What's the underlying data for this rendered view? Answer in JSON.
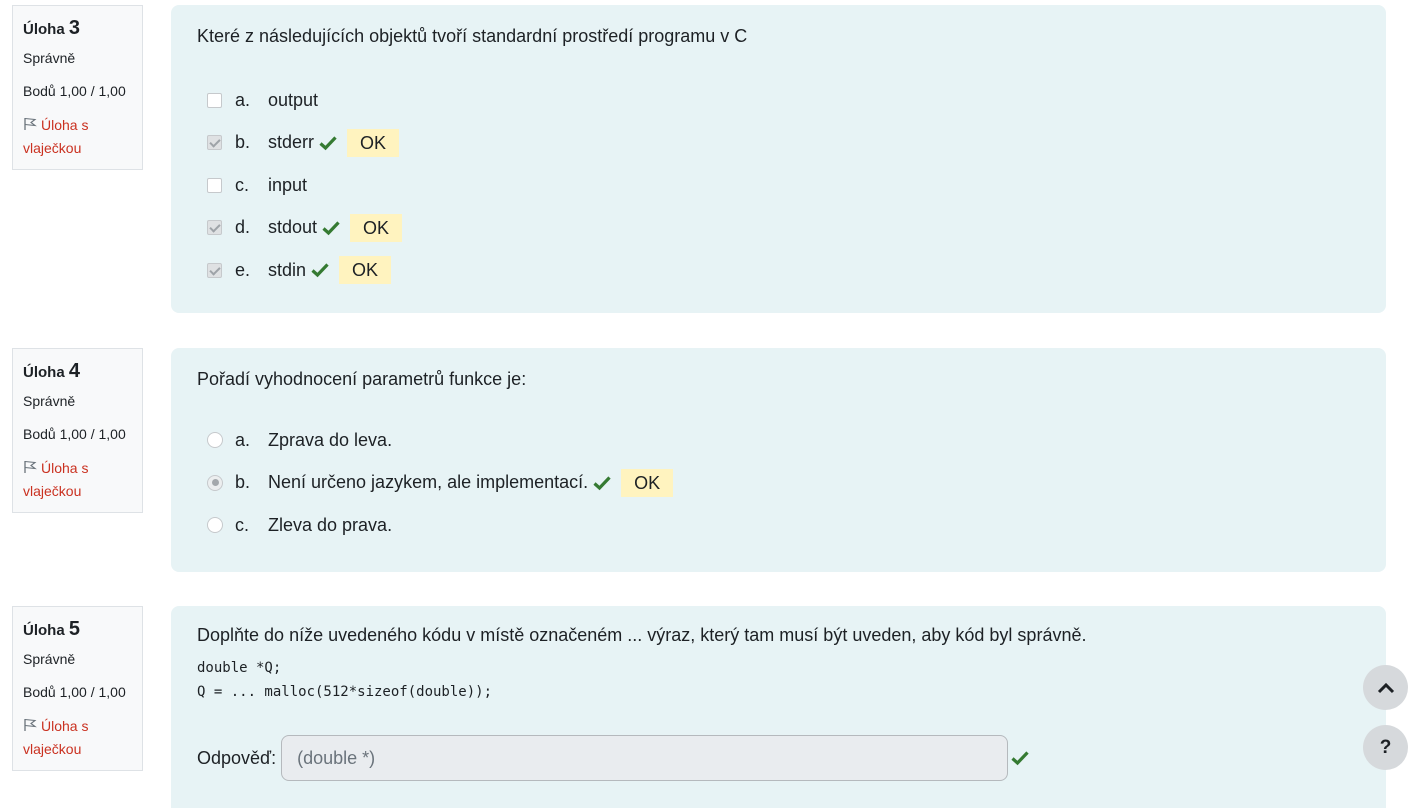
{
  "colors": {
    "content_bg": "#e7f3f5",
    "info_bg": "#f8f9fa",
    "flag_red": "#ca3120",
    "tick_green": "#357a32",
    "feedback_bg": "#fff3bf"
  },
  "questions": [
    {
      "label": "Úloha",
      "number": "3",
      "state": "Správně",
      "grade": "Bodů 1,00 / 1,00",
      "flag_label": "Úloha s vlaječkou",
      "text": "Které z následujících objektů tvoří standardní prostředí programu v C",
      "type": "checkbox",
      "answers": [
        {
          "letter": "a.",
          "text": "output",
          "checked": false,
          "feedback": ""
        },
        {
          "letter": "b.",
          "text": "stderr",
          "checked": true,
          "feedback": "OK"
        },
        {
          "letter": "c.",
          "text": "input",
          "checked": false,
          "feedback": ""
        },
        {
          "letter": "d.",
          "text": "stdout",
          "checked": true,
          "feedback": "OK"
        },
        {
          "letter": "e.",
          "text": "stdin",
          "checked": true,
          "feedback": "OK"
        }
      ]
    },
    {
      "label": "Úloha",
      "number": "4",
      "state": "Správně",
      "grade": "Bodů 1,00 / 1,00",
      "flag_label": "Úloha s vlaječkou",
      "text": "Pořadí vyhodnocení parametrů funkce je:",
      "type": "radio",
      "answers": [
        {
          "letter": "a.",
          "text": "Zprava do leva.",
          "checked": false,
          "feedback": ""
        },
        {
          "letter": "b.",
          "text": "Není určeno jazykem, ale implementací.",
          "checked": true,
          "feedback": "OK"
        },
        {
          "letter": "c.",
          "text": "Zleva do prava.",
          "checked": false,
          "feedback": ""
        }
      ]
    },
    {
      "label": "Úloha",
      "number": "5",
      "state": "Správně",
      "grade": "Bodů 1,00 / 1,00",
      "flag_label": "Úloha s vlaječkou",
      "text": "Doplňte do níže uvedeného kódu v místě označeném ... výraz, který tam musí být uveden, aby kód byl správně.",
      "code_lines": [
        "double *Q;",
        "Q = ... malloc(512*sizeof(double));"
      ],
      "answer_label": "Odpověď:",
      "answer_value": "(double *)"
    }
  ],
  "scroll_top_icon": "chevron-up-icon",
  "help_button_label": "?"
}
